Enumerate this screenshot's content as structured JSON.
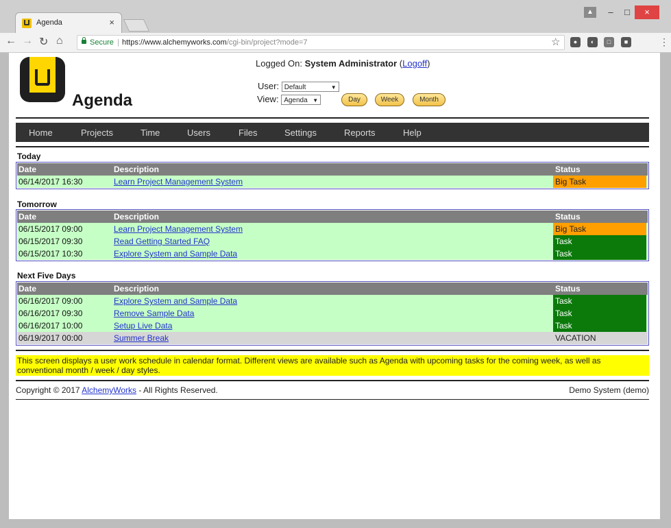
{
  "browser": {
    "tab_title": "Agenda",
    "tab_close": "×",
    "secure_label": "Secure",
    "url_host": "https://www.alchemyworks.com",
    "url_path": "/cgi-bin/project?mode=7",
    "star_icon": "☆",
    "window": {
      "minimize": "–",
      "maximize": "□",
      "close": "×"
    }
  },
  "header": {
    "app_title": "Agenda",
    "logged_on_prefix": "Logged On:",
    "user_name": "System Administrator",
    "logoff_label": "Logoff",
    "user_label": "User:",
    "user_value": "Default",
    "view_label": "View:",
    "view_value": "Agenda",
    "view_buttons": {
      "day": "Day",
      "week": "Week",
      "month": "Month"
    }
  },
  "nav": {
    "items": [
      "Home",
      "Projects",
      "Time",
      "Users",
      "Files",
      "Settings",
      "Reports",
      "Help"
    ]
  },
  "columns": {
    "date": "Date",
    "description": "Description",
    "status": "Status"
  },
  "sections": [
    {
      "title": "Today",
      "rows": [
        {
          "date": "06/14/2017 16:30",
          "description": "Learn Project Management System",
          "status": "Big Task"
        }
      ]
    },
    {
      "title": "Tomorrow",
      "rows": [
        {
          "date": "06/15/2017 09:00",
          "description": "Learn Project Management System",
          "status": "Big Task"
        },
        {
          "date": "06/15/2017 09:30",
          "description": "Read Getting Started FAQ",
          "status": "Task"
        },
        {
          "date": "06/15/2017 10:30",
          "description": "Explore System and Sample Data",
          "status": "Task"
        }
      ]
    },
    {
      "title": "Next Five Days",
      "rows": [
        {
          "date": "06/16/2017 09:00",
          "description": "Explore System and Sample Data",
          "status": "Task"
        },
        {
          "date": "06/16/2017 09:30",
          "description": "Remove Sample Data",
          "status": "Task"
        },
        {
          "date": "06/16/2017 10:00",
          "description": "Setup Live Data",
          "status": "Task"
        },
        {
          "date": "06/19/2017 00:00",
          "description": "Summer Break",
          "status": "VACATION"
        }
      ]
    }
  ],
  "info_note": "This screen displays a user work schedule in calendar format. Different views are available such as Agenda with upcoming tasks for the coming week, as well as conventional month / week / day styles.",
  "footer": {
    "copyright_prefix": "Copyright © 2017",
    "company_link": "AlchemyWorks",
    "copyright_suffix": "- All Rights Reserved.",
    "system_label": "Demo System (demo)"
  },
  "colors": {
    "nav_bg": "#333333",
    "row_green": "#c6ffc6",
    "status_big_task": "#ff9f00",
    "status_task": "#0b7a0b",
    "status_vacation": "#d6d6d6",
    "note_bg": "#ffff00",
    "table_border": "#5151c0"
  }
}
